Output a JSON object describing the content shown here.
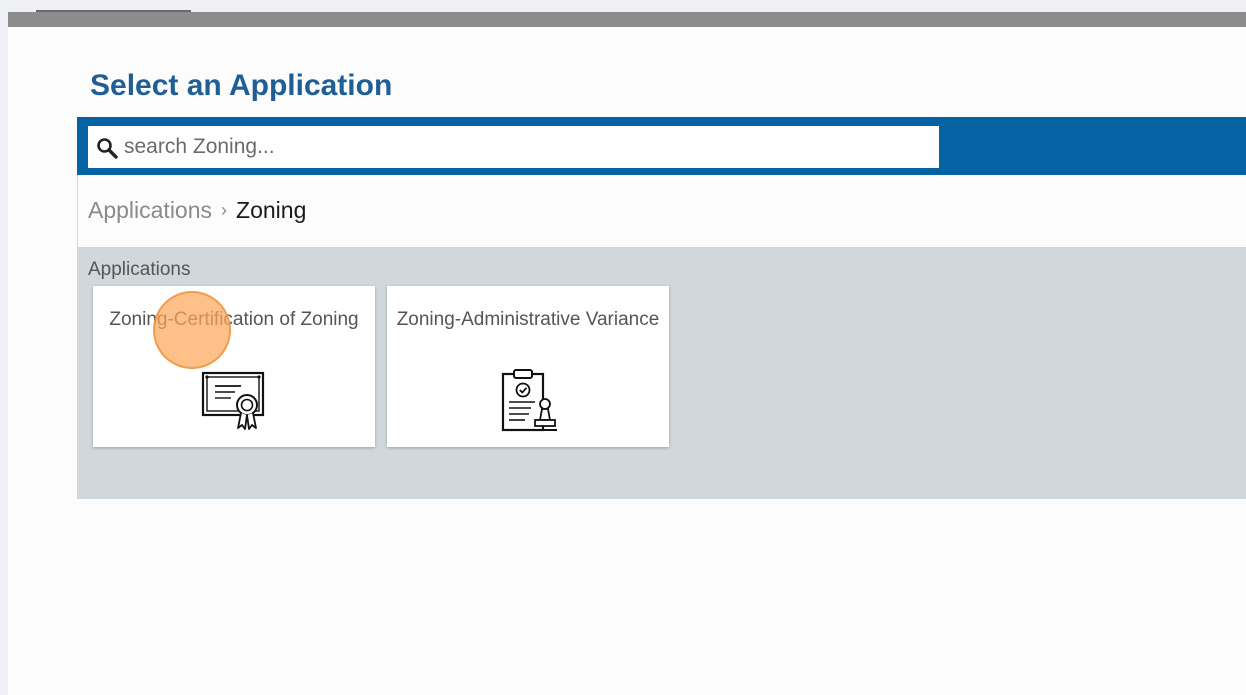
{
  "page": {
    "title": "Select an Application"
  },
  "search": {
    "placeholder": "search Zoning...",
    "value": ""
  },
  "breadcrumb": {
    "items": [
      "Applications",
      "Zoning"
    ],
    "separator": "›"
  },
  "apps_section": {
    "label": "Applications",
    "cards": [
      {
        "title": "Zoning-Certification of Zoning",
        "icon": "certificate-icon"
      },
      {
        "title": "Zoning-Administrative Variance",
        "icon": "clipboard-stamp-icon"
      }
    ]
  },
  "colors": {
    "brand_blue": "#0562a3",
    "title_blue": "#205f96",
    "panel_gray": "#d0d8dc",
    "click_indicator": "#fba85a"
  }
}
